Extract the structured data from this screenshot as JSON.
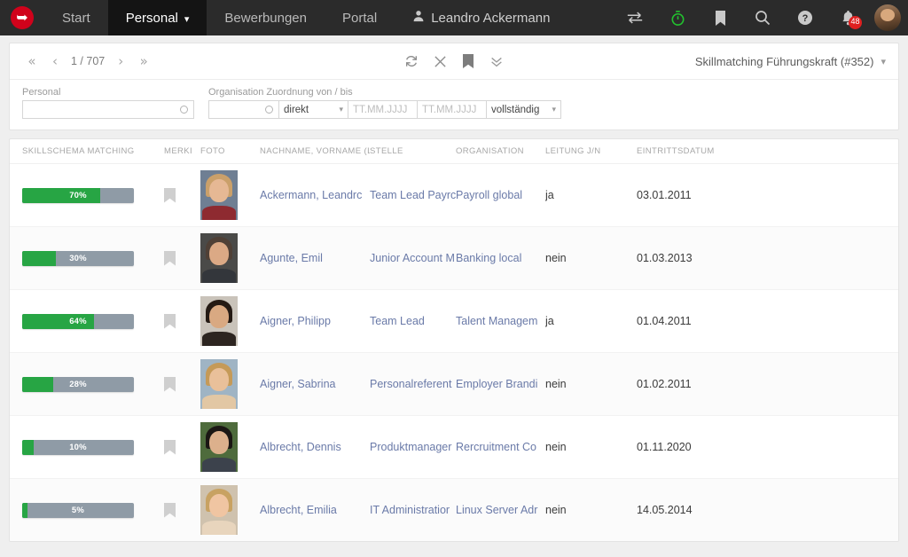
{
  "topnav": {
    "logo_icon": "company-logo-icon",
    "items": [
      {
        "label": "Start",
        "active": false,
        "caret": false
      },
      {
        "label": "Personal",
        "active": true,
        "caret": true
      },
      {
        "label": "Bewerbungen",
        "active": false,
        "caret": false
      },
      {
        "label": "Portal",
        "active": false,
        "caret": false
      }
    ],
    "user": {
      "label": "Leandro Ackermann",
      "icon": "person-icon"
    },
    "icons": [
      {
        "name": "swap-arrows-icon"
      },
      {
        "name": "stopwatch-icon",
        "color": "#22c32e"
      },
      {
        "name": "bookmark-icon"
      },
      {
        "name": "search-icon"
      },
      {
        "name": "help-circle-icon"
      },
      {
        "name": "bell-icon",
        "badge": "48"
      }
    ],
    "avatar": "user-avatar"
  },
  "toolbar": {
    "first_label": "«",
    "prev_label": "‹",
    "page_label": "1 / 707",
    "next_label": "›",
    "last_label": "»",
    "refresh_icon": "refresh-icon",
    "close_icon": "close-icon",
    "bookmark_icon": "bookmark-filled-icon",
    "expand_icon": "chevron-double-down-icon",
    "view_label": "Skillmatching Führungskraft (#352)",
    "view_caret": "⌵"
  },
  "filters": {
    "personal": {
      "label": "Personal",
      "value": "",
      "placeholder": "",
      "lookup_icon": "lookup-circle-icon"
    },
    "organisation": {
      "label": "Organisation Zuordnung von / bis",
      "value": "",
      "lookup_icon": "lookup-circle-icon",
      "mode": {
        "value": "direkt",
        "caret": "⌵"
      },
      "date_from": {
        "placeholder": "TT.MM.JJJJ",
        "value": ""
      },
      "date_to": {
        "placeholder": "TT.MM.JJJJ",
        "value": ""
      },
      "completeness": {
        "value": "vollständig",
        "caret": "⌵"
      }
    }
  },
  "table": {
    "columns": [
      "SKILLSCHEMA MATCHING",
      "MERKI",
      "FOTO",
      "NACHNAME, VORNAME (LINK",
      "STELLE",
      "ORGANISATION",
      "LEITUNG J/N",
      "EINTRITTSDATUM"
    ],
    "rows": [
      {
        "match_pct": 70,
        "match_label": "70%",
        "flag": "bookmark-flag-icon",
        "photo": "portrait-photo",
        "name": "Ackermann, Leandrc",
        "stelle": "Team Lead Payrc",
        "organisation": "Payroll global",
        "leitung": "ja",
        "eintrittsdatum": "03.01.2011",
        "photo_colors": {
          "bg": "#6f7f93",
          "hair": "#caa06a",
          "skin": "#e6b894",
          "body": "#8e2a30"
        }
      },
      {
        "match_pct": 30,
        "match_label": "30%",
        "flag": "bookmark-flag-icon",
        "photo": "portrait-photo",
        "name": "Agunte, Emil",
        "stelle": "Junior Account M",
        "organisation": "Banking local",
        "leitung": "nein",
        "eintrittsdatum": "01.03.2013",
        "photo_colors": {
          "bg": "#4a4a48",
          "hair": "#4f4036",
          "skin": "#dba985",
          "body": "#33363b"
        }
      },
      {
        "match_pct": 64,
        "match_label": "64%",
        "flag": "bookmark-flag-icon",
        "photo": "portrait-photo",
        "name": "Aigner, Philipp",
        "stelle": "Team Lead",
        "organisation": "Talent Managem",
        "leitung": "ja",
        "eintrittsdatum": "01.04.2011",
        "photo_colors": {
          "bg": "#c9c3ba",
          "hair": "#241a14",
          "skin": "#d9a982",
          "body": "#2d2520"
        }
      },
      {
        "match_pct": 28,
        "match_label": "28%",
        "flag": "bookmark-flag-icon",
        "photo": "portrait-photo",
        "name": "Aigner, Sabrina",
        "stelle": "Personalreferent",
        "organisation": "Employer Brandi",
        "leitung": "nein",
        "eintrittsdatum": "01.02.2011",
        "photo_colors": {
          "bg": "#9fb4c4",
          "hair": "#c59a58",
          "skin": "#e9c09a",
          "body": "#e2c7a4"
        }
      },
      {
        "match_pct": 10,
        "match_label": "10%",
        "flag": "bookmark-flag-icon",
        "photo": "portrait-photo",
        "name": "Albrecht, Dennis",
        "stelle": "Produktmanager",
        "organisation": "Rercruitment Co",
        "leitung": "nein",
        "eintrittsdatum": "01.11.2020",
        "photo_colors": {
          "bg": "#4e6b3c",
          "hair": "#1b1714",
          "skin": "#dcb08c",
          "body": "#3c424c"
        }
      },
      {
        "match_pct": 5,
        "match_label": "5%",
        "flag": "bookmark-flag-icon",
        "photo": "portrait-photo",
        "name": "Albrecht, Emilia",
        "stelle": "IT Administratior",
        "organisation": "Linux Server Adr",
        "leitung": "nein",
        "eintrittsdatum": "14.05.2014",
        "photo_colors": {
          "bg": "#cfc2ae",
          "hair": "#c8a262",
          "skin": "#f0c5a2",
          "body": "#e8d5bd"
        }
      }
    ]
  },
  "colors": {
    "brand_red": "#d0021b",
    "bar_green": "#27a544",
    "bar_track": "#8f9ba6",
    "link_blue": "#6a7aa8",
    "nav_bg": "#2b2b2b"
  }
}
